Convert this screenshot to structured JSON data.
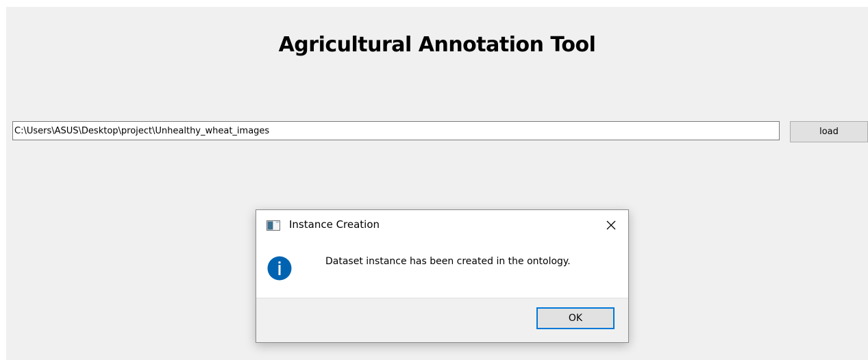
{
  "app": {
    "title": "Agricultural Annotation Tool"
  },
  "path_field": {
    "value": "C:\\Users\\ASUS\\Desktop\\project\\Unhealthy_wheat_images"
  },
  "load_button": {
    "label": "load"
  },
  "dialog": {
    "title": "Instance Creation",
    "message": "Dataset instance has been created in the ontology.",
    "ok_label": "OK",
    "icon": "info-icon",
    "close_icon": "close-icon"
  },
  "colors": {
    "window_bg": "#f0f0f0",
    "info_icon": "#0063b1",
    "focus_border": "#0078d7"
  }
}
